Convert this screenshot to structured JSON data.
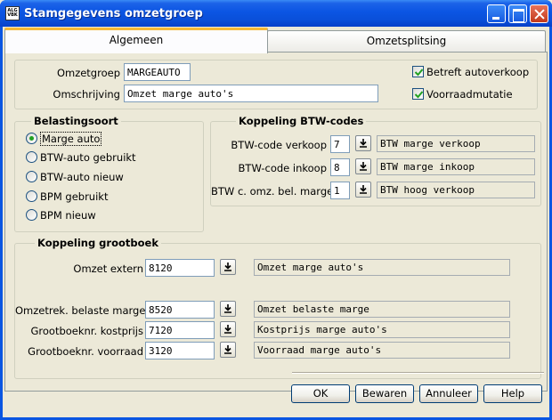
{
  "window": {
    "title": "Stamgegevens omzetgroep",
    "icon_text": "ALG VBK"
  },
  "tabs": [
    {
      "label": "Algemeen"
    },
    {
      "label": "Omzetsplitsing"
    }
  ],
  "general": {
    "omzetgroep_label": "Omzetgroep",
    "omzetgroep_value": "MARGEAUTO",
    "omschrijving_label": "Omschrijving",
    "omschrijving_value": "Omzet marge auto's",
    "betreft_autoverkoop": {
      "label": "Betreft autoverkoop",
      "checked": true
    },
    "voorraadmutatie": {
      "label": "Voorraadmutatie",
      "checked": true
    }
  },
  "belastingsoort": {
    "title": "Belastingsoort",
    "options": [
      {
        "label": "Marge auto",
        "selected": true
      },
      {
        "label": "BTW-auto gebruikt",
        "selected": false
      },
      {
        "label": "BTW-auto nieuw",
        "selected": false
      },
      {
        "label": "BPM gebruikt",
        "selected": false
      },
      {
        "label": "BPM nieuw",
        "selected": false
      }
    ]
  },
  "btw_codes": {
    "title": "Koppeling BTW-codes",
    "rows": [
      {
        "label": "BTW-code verkoop",
        "code": "7",
        "description": "BTW marge verkoop"
      },
      {
        "label": "BTW-code inkoop",
        "code": "8",
        "description": "BTW marge inkoop"
      },
      {
        "label": "BTW c. omz. bel. marge",
        "code": "1",
        "description": "BTW hoog verkoop"
      }
    ]
  },
  "grootboek": {
    "title": "Koppeling grootboek",
    "rows": [
      {
        "label": "Omzet extern",
        "account": "8120",
        "description": "Omzet marge auto's"
      },
      {
        "label": "Omzetrek. belaste marge",
        "account": "8520",
        "description": "Omzet belaste marge"
      },
      {
        "label": "Grootboeknr. kostprijs",
        "account": "7120",
        "description": "Kostprijs marge auto's"
      },
      {
        "label": "Grootboeknr. voorraad",
        "account": "3120",
        "description": "Voorraad marge auto's"
      }
    ]
  },
  "buttons": {
    "ok": "OK",
    "bewaren": "Bewaren",
    "annuleer": "Annuleer",
    "help": "Help"
  },
  "colors": {
    "titlebar": "#0A56E2",
    "dialog_bg": "#ECE9D8",
    "tab_highlight": "#F5B937",
    "check": "#21A121"
  }
}
